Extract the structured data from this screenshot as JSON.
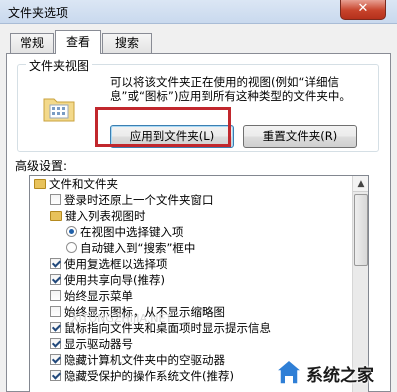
{
  "window": {
    "title": "文件夹选项",
    "close_glyph": "✕"
  },
  "tabs": [
    {
      "label": "常规",
      "active": false
    },
    {
      "label": "查看",
      "active": true
    },
    {
      "label": "搜索",
      "active": false
    }
  ],
  "folder_views": {
    "group_title": "文件夹视图",
    "description": "可以将该文件夹正在使用的视图(例如“详细信息”或“图标”)应用到所有这种类型的文件夹中。",
    "apply_button": "应用到文件夹(L)",
    "reset_button": "重置文件夹(R)"
  },
  "advanced": {
    "label": "高级设置:",
    "items": [
      {
        "type": "folder",
        "text": "文件和文件夹"
      },
      {
        "type": "checkbox",
        "checked": false,
        "text": "登录时还原上一个文件夹窗口"
      },
      {
        "type": "folder",
        "text": "键入列表视图时"
      },
      {
        "type": "radio",
        "checked": true,
        "text": "在视图中选择键入项"
      },
      {
        "type": "radio",
        "checked": false,
        "text": "自动键入到“搜索”框中"
      },
      {
        "type": "checkbox",
        "checked": true,
        "text": "使用复选框以选择项"
      },
      {
        "type": "checkbox",
        "checked": true,
        "text": "使用共享向导(推荐)"
      },
      {
        "type": "checkbox",
        "checked": false,
        "text": "始终显示菜单"
      },
      {
        "type": "checkbox",
        "checked": false,
        "text": "始终显示图标，从不显示缩略图"
      },
      {
        "type": "checkbox",
        "checked": true,
        "text": "鼠标指向文件夹和桌面项时显示提示信息"
      },
      {
        "type": "checkbox",
        "checked": true,
        "text": "显示驱动器号"
      },
      {
        "type": "checkbox",
        "checked": true,
        "text": "隐藏计算机文件夹中的空驱动器"
      },
      {
        "type": "checkbox",
        "checked": true,
        "text": "隐藏受保护的操作系统文件(推荐)"
      }
    ],
    "scroll_up_glyph": "▲"
  },
  "watermark": {
    "text": "系统之家",
    "faint_text": "XITONGZHIJIA.NET"
  },
  "colors": {
    "highlight": "#c1272d",
    "close_button": "#c7432b"
  }
}
